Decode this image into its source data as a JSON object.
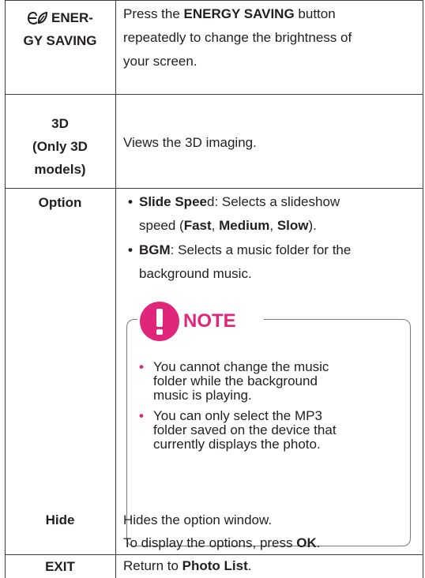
{
  "rows": [
    {
      "label_icon": "energy-saving-icon",
      "label_line1": "ENER-",
      "label_line2": "GY SAVING",
      "desc_line1": [
        "Press the ",
        "ENERGY SAVING",
        " button"
      ],
      "desc_line2": "repeatedly to change the brightness of",
      "desc_line3": "your screen."
    },
    {
      "label_line1": "3D",
      "label_line2": "(Only 3D",
      "label_line3": "models)",
      "desc": "Views the 3D imaging."
    },
    {
      "label": "Option",
      "bullet1_bold": "Slide Spee",
      "bullet1_rest": "d: Selects a slideshow",
      "bullet1_line2_a": "speed (",
      "bullet1_fast": "Fast",
      "bullet1_sep1": ", ",
      "bullet1_medium": "Medium",
      "bullet1_sep2": ", ",
      "bullet1_slow": "Slow",
      "bullet1_end": ").",
      "bullet2_bold": "BGM",
      "bullet2_rest": ": Selects a music folder for the",
      "bullet2_line2": "background music.",
      "bullet_char": "•"
    },
    {
      "label": "Hide",
      "desc_line1": "Hides the option window.",
      "desc_line2_a": "To display the options, press ",
      "desc_line2_b": "OK",
      "desc_line2_c": "."
    },
    {
      "label": "EXIT",
      "desc_a": "Return to ",
      "desc_b": "Photo List",
      "desc_c": "."
    }
  ],
  "note": {
    "title": "NOTE",
    "icon": "exclamation-icon",
    "accent": "#e0267a",
    "item1_l1": "You cannot change the music",
    "item1_l2": "folder while the background",
    "item1_l3": "music is playing.",
    "item2_l1": "You can only select the MP3",
    "item2_l2": "folder saved on the device that",
    "item2_l3": "currently displays the photo.",
    "bullet_char": "•"
  }
}
